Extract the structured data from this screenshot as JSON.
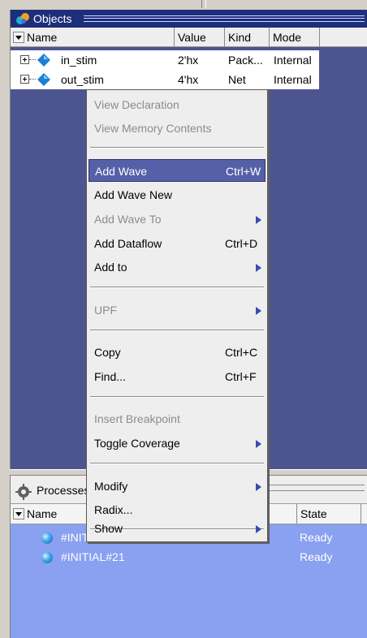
{
  "objects_pane": {
    "title": "Objects",
    "columns": [
      "Name",
      "Value",
      "Kind",
      "Mode"
    ],
    "rows": [
      {
        "name": "in_stim",
        "value": "2'hx",
        "kind": "Pack...",
        "mode": "Internal"
      },
      {
        "name": "out_stim",
        "value": "4'hx",
        "kind": "Net",
        "mode": "Internal"
      }
    ]
  },
  "processes_pane": {
    "title": "Processes",
    "columns": [
      "Name",
      "State"
    ],
    "rows": [
      {
        "name": "#INITIAL#20",
        "state": "Ready"
      },
      {
        "name": "#INITIAL#21",
        "state": "Ready"
      }
    ]
  },
  "context_menu": {
    "items": [
      {
        "label": "View Declaration",
        "enabled": false
      },
      {
        "label": "View Memory Contents",
        "enabled": false
      },
      {
        "label": "Add Wave",
        "shortcut": "Ctrl+W",
        "highlighted": true
      },
      {
        "label": "Add Wave New"
      },
      {
        "label": "Add Wave To",
        "enabled": false,
        "submenu": true
      },
      {
        "label": "Add Dataflow",
        "shortcut": "Ctrl+D"
      },
      {
        "label": "Add to",
        "submenu": true
      },
      {
        "label": "UPF",
        "enabled": false,
        "submenu": true
      },
      {
        "label": "Copy",
        "shortcut": "Ctrl+C"
      },
      {
        "label": "Find...",
        "shortcut": "Ctrl+F"
      },
      {
        "label": "Insert Breakpoint",
        "enabled": false
      },
      {
        "label": "Toggle Coverage",
        "submenu": true
      },
      {
        "label": "Modify",
        "submenu": true
      },
      {
        "label": "Radix..."
      },
      {
        "label": "Show",
        "submenu": true
      }
    ]
  },
  "colors": {
    "objects_bg": "#4d5590",
    "header_bar": "#1d2f7a",
    "menu_highlight": "#5560a8",
    "processes_bg": "#8aa0f0"
  }
}
